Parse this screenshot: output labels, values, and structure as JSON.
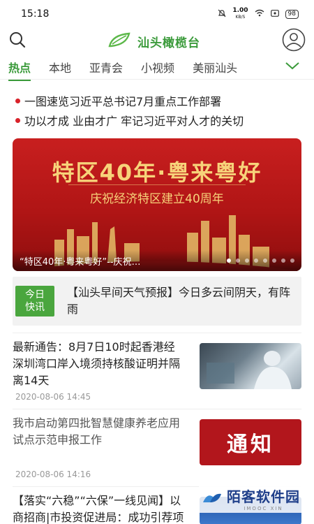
{
  "status": {
    "time": "15:18",
    "net_speed": "1.00",
    "net_unit": "KB/S",
    "battery": "98"
  },
  "app": {
    "name": "汕头橄榄台"
  },
  "tabs": [
    "热点",
    "本地",
    "亚青会",
    "小视频",
    "美丽汕头"
  ],
  "headlines": [
    "一图速览习近平总书记7月重点工作部署",
    "功以才成 业由才广 牢记习近平对人才的关切"
  ],
  "banner": {
    "title": "特区40年·粤来粤好",
    "subtitle": "庆祝经济特区建立40周年",
    "caption": "“特区40年·粤来粤好”--庆祝…"
  },
  "express": {
    "badge_line1": "今日",
    "badge_line2": "快讯",
    "text": "【汕头早间天气预报】今日多云间阴天，有阵雨"
  },
  "articles": [
    {
      "title": "最新通告：8月7日10时起香港经深圳湾口岸入境须持核酸证明并隔离14天",
      "date": "2020-08-06 14:45",
      "thumb": "photo"
    },
    {
      "title": "我市启动第四批智慧健康养老应用试点示范申报工作",
      "date": "2020-08-06 14:16",
      "thumb": "通知"
    },
    {
      "title": "【落实“六稳”“六保”一线见闻】以商招商|市投资促进局：成功引荐项目有奖..",
      "date": "",
      "thumb": "blue"
    }
  ],
  "watermark": {
    "text": "陌客软件园",
    "sub": "IMOOC XIN"
  },
  "colors": {
    "brand": "#3a9a3a",
    "accent_red": "#d9222a",
    "badge_green": "#4aa63e"
  }
}
